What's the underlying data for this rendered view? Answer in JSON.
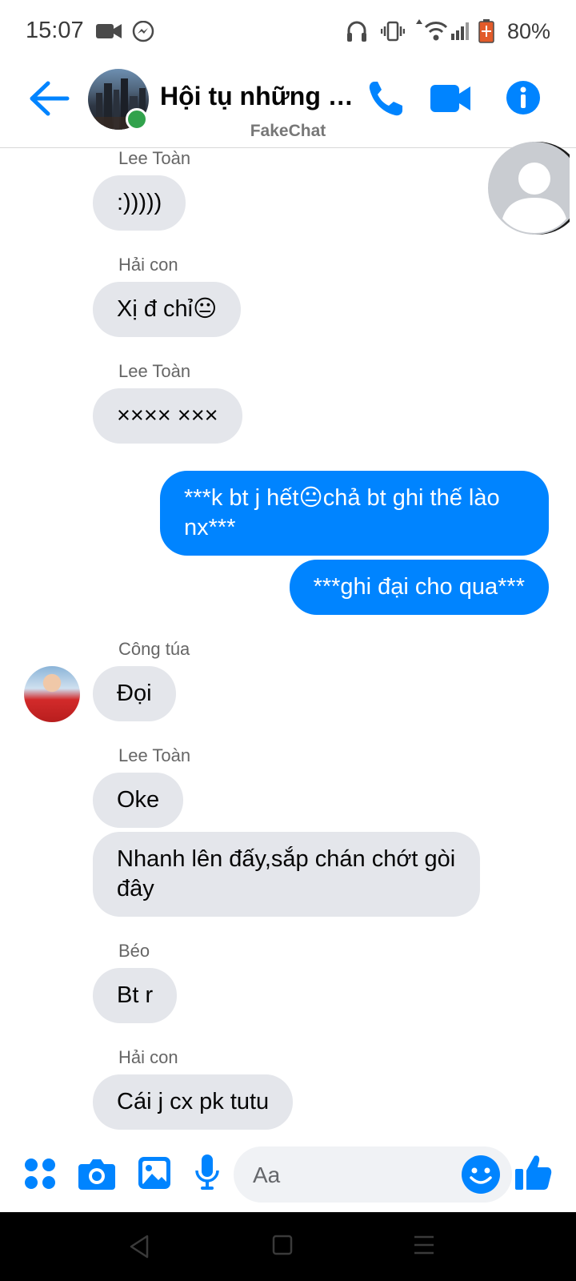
{
  "status_bar": {
    "time": "15:07",
    "battery": "80%"
  },
  "header": {
    "title": "Hội tụ những n...",
    "subtitle": "FakeChat"
  },
  "colors": {
    "accent": "#0084ff",
    "incoming_bubble": "#e4e6eb",
    "online": "#31a24c"
  },
  "messages": [
    {
      "sender": "Lee Toàn",
      "text": ":)))))"
    },
    {
      "sender": "Hải con",
      "text": "Xị đ chỉ😐"
    },
    {
      "sender": "Lee Toàn",
      "text": "×××× ×××"
    },
    {
      "text": "***k bt j hết😐chả bt ghi thế lào nx***"
    },
    {
      "text": "***ghi đại cho qua***"
    },
    {
      "sender": "Công túa",
      "text": "Đọi"
    },
    {
      "sender": "Lee Toàn",
      "text": "Oke"
    },
    {
      "text": "Nhanh lên đấy,sắp chán chớt gòi đây"
    },
    {
      "sender": "Béo",
      "text": "Bt r"
    },
    {
      "sender": "Hải con",
      "text": "Cái j cx pk tutu"
    }
  ],
  "composer": {
    "placeholder": "Aa"
  },
  "icons": {
    "back": "arrow-left-icon",
    "call": "phone-icon",
    "video": "video-camera-icon",
    "info": "info-icon",
    "apps": "four-dots-icon",
    "camera": "camera-icon",
    "gallery": "image-icon",
    "mic": "microphone-icon",
    "emoji": "smiley-icon",
    "like": "thumbs-up-icon"
  }
}
